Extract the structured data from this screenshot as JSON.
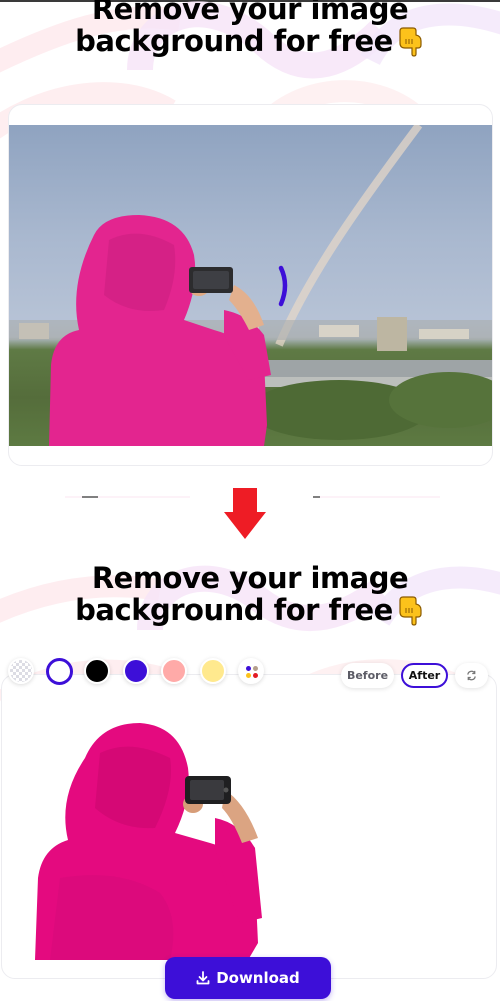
{
  "sections": {
    "original": {
      "headline_line1": "Remove your image",
      "headline_line2": "background for free",
      "emoji": "backhand-index-pointing-down",
      "image": "person-in-pink-hoodie-photographing-rainbow",
      "status": "loading"
    },
    "result": {
      "headline_line1": "Remove your image",
      "headline_line2": "background for free",
      "emoji": "backhand-index-pointing-down",
      "image": "person-in-pink-hoodie-cutout"
    }
  },
  "transition_arrow": {
    "icon": "arrow-down-icon",
    "color": "#ee1c25"
  },
  "background_swatches": [
    {
      "name": "transparent",
      "color": "transparent"
    },
    {
      "name": "white",
      "color": "#ffffff",
      "selected": true
    },
    {
      "name": "black",
      "color": "#000000"
    },
    {
      "name": "violet",
      "color": "#3d0fd8"
    },
    {
      "name": "pink",
      "color": "#ffaaa8"
    },
    {
      "name": "yellow",
      "color": "#ffe98e"
    },
    {
      "name": "more-colors",
      "color": "palette"
    }
  ],
  "view_toggle": {
    "before_label": "Before",
    "after_label": "After",
    "active": "After",
    "swap_icon": "swap-icon"
  },
  "download": {
    "label": "Download",
    "icon": "download-icon"
  },
  "colors": {
    "accent": "#3d0fd8",
    "arrow": "#ee1c25",
    "hoodie": "#e0207f"
  }
}
